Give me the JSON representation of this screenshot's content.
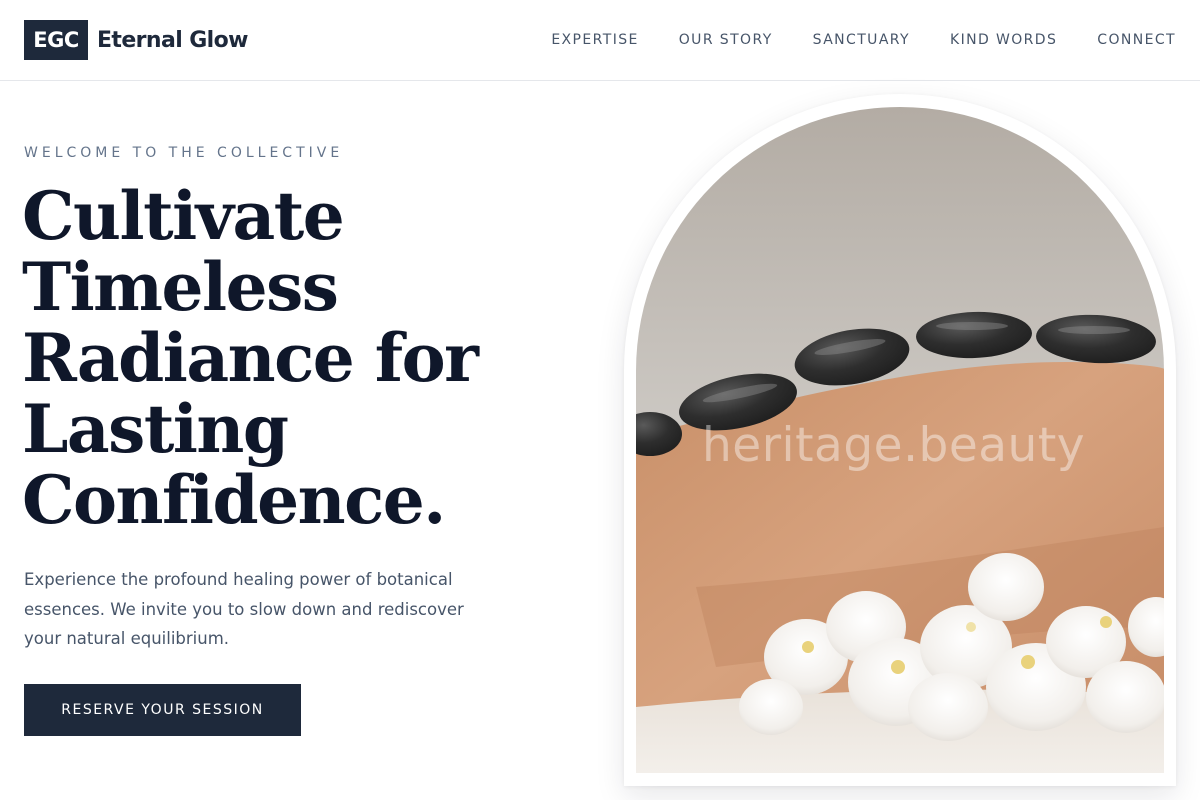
{
  "brand": {
    "mark": "EGC",
    "name": "Eternal Glow"
  },
  "nav": {
    "items": [
      {
        "label": "EXPERTISE"
      },
      {
        "label": "OUR STORY"
      },
      {
        "label": "SANCTUARY"
      },
      {
        "label": "KIND WORDS"
      },
      {
        "label": "CONNECT"
      }
    ]
  },
  "hero": {
    "eyebrow": "WELCOME TO THE COLLECTIVE",
    "headline_lines": [
      "Cultivate",
      "Timeless",
      "Radiance for",
      "Lasting",
      "Confidence."
    ],
    "intro": "Experience the profound healing power of botanical essences. We invite you to slow down and rediscover your natural equilibrium.",
    "cta_label": "RESERVE YOUR SESSION"
  },
  "image": {
    "subject": "hot stones on back with white orchids",
    "watermark": "heritage.beauty"
  },
  "colors": {
    "primary": "#1e293b",
    "heading": "#0f172a",
    "body_text": "#475569",
    "muted": "#64748b",
    "background": "#ffffff"
  }
}
